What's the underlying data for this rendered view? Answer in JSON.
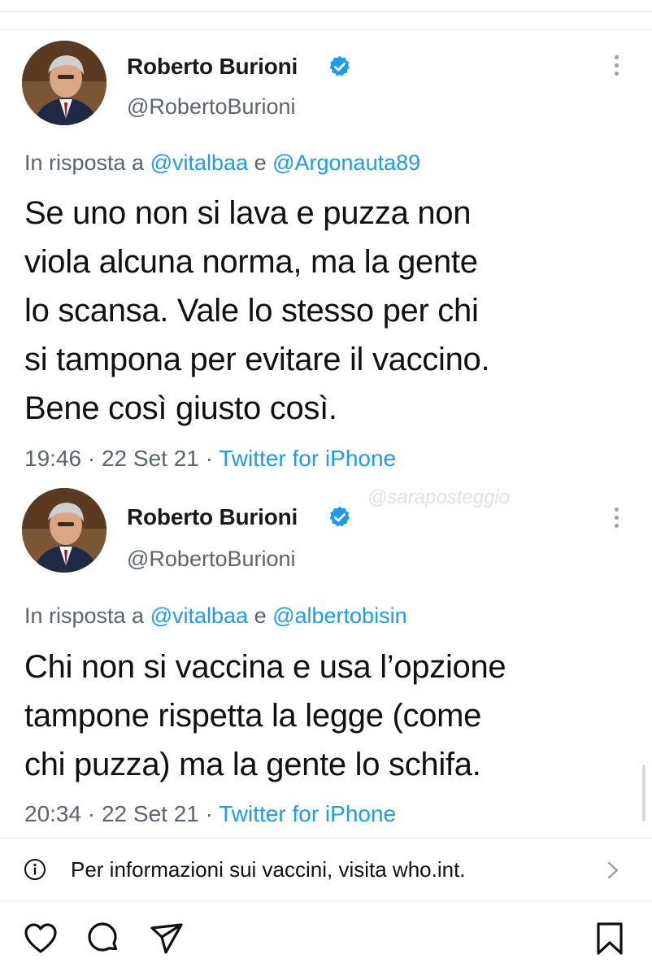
{
  "tweets": [
    {
      "name": "Roberto Burioni",
      "handle": "@RobertoBurioni",
      "reply_prefix": "In risposta a ",
      "reply_mention_1": "@vitalbaa",
      "reply_conjunction": " e ",
      "reply_mention_2": "@Argonauta89",
      "text": "Se uno non si lava e puzza non\nviola alcuna norma, ma la gente\nlo scansa. Vale lo stesso per chi\nsi tampona per evitare il vaccino.\nBene così giusto così.",
      "time": "19:46",
      "date": "22 Set 21",
      "separator": " · ",
      "source": "Twitter for iPhone"
    },
    {
      "name": "Roberto Burioni",
      "handle": "@RobertoBurioni",
      "reply_prefix": "In risposta a ",
      "reply_mention_1": "@vitalbaa",
      "reply_conjunction": " e ",
      "reply_mention_2": "@albertobisin",
      "text": "Chi non si vaccina e usa l’opzione\ntampone rispetta la legge (come\nchi puzza) ma la gente lo schifa.",
      "time": "20:34",
      "date": "22 Set 21",
      "separator": " · ",
      "source": "Twitter for iPhone"
    }
  ],
  "watermark": "@saraposteggio",
  "info_banner": {
    "text": "Per informazioni sui vaccini, visita who.int.",
    "icon": "info-icon"
  },
  "actions": {
    "icons": [
      "heart-icon",
      "comment-icon",
      "share-icon",
      "bookmark-icon"
    ]
  },
  "colors": {
    "link": "#1d9bf0",
    "secondary_text": "#5b6570",
    "verified": "#1d9bf0"
  }
}
